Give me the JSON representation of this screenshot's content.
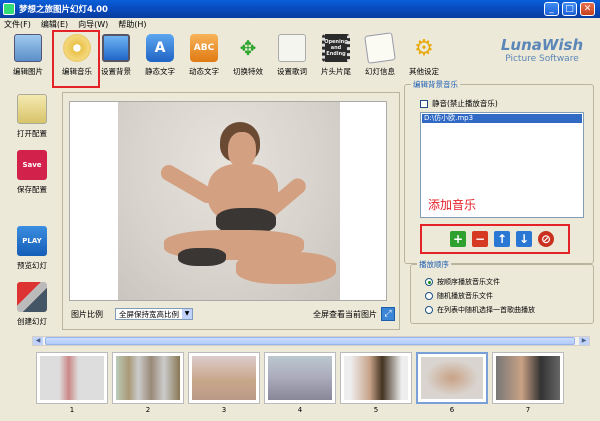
{
  "app": {
    "title": "梦想之旅图片幻灯4.00"
  },
  "window_controls": {
    "minimize": "_",
    "maximize": "□",
    "close": "✕"
  },
  "menu": [
    "文件(F)",
    "编辑(E)",
    "向导(W)",
    "帮助(H)"
  ],
  "toolbar": [
    {
      "label": "编辑图片",
      "icon": "image-icon"
    },
    {
      "label": "编辑音乐",
      "icon": "music-cd-icon"
    },
    {
      "label": "设置背景",
      "icon": "monitor-icon"
    },
    {
      "label": "静态文字",
      "icon": "letter-a-icon"
    },
    {
      "label": "动态文字",
      "icon": "abc-icon"
    },
    {
      "label": "切换特效",
      "icon": "arrows-icon"
    },
    {
      "label": "设置歌词",
      "icon": "lyrics-icon"
    },
    {
      "label": "片头片尾",
      "icon": "film-icon"
    },
    {
      "label": "幻灯信息",
      "icon": "notepad-icon"
    },
    {
      "label": "其他设定",
      "icon": "gears-icon"
    }
  ],
  "toolbar_glyphs": {
    "abc": "ABC",
    "a": "A",
    "film": "Opening and Ending"
  },
  "logo": {
    "line1": "LunaWish",
    "line2": "Picture Software"
  },
  "sidebar": [
    {
      "label": "打开配置",
      "icon": "open-config-icon"
    },
    {
      "label": "保存配置",
      "icon": "save-config-icon",
      "glyph": "Save"
    },
    {
      "label": "预览幻灯",
      "icon": "preview-play-icon",
      "glyph": "PLAY"
    },
    {
      "label": "创建幻灯",
      "icon": "create-tools-icon"
    }
  ],
  "preview": {
    "ratio_label": "图片比例",
    "ratio_value": "全屏保持宽高比例",
    "fullscreen_label": "全屏查看当前图片"
  },
  "music": {
    "group_title": "编辑背景音乐",
    "mute_label": "静音(禁止播放音乐)",
    "mute_checked": false,
    "list": [
      "D:\\仿小欧.mp3"
    ],
    "annotation": "添加音乐",
    "buttons": [
      {
        "name": "add",
        "glyph": "+",
        "color": "#2fa12f"
      },
      {
        "name": "remove",
        "glyph": "−",
        "color": "#d63a22"
      },
      {
        "name": "move-up",
        "glyph": "↑",
        "color": "#2b78d4"
      },
      {
        "name": "move-down",
        "glyph": "↓",
        "color": "#2b78d4"
      },
      {
        "name": "clear",
        "glyph": "⊘",
        "color": "#c9301f"
      }
    ]
  },
  "order": {
    "group_title": "播放顺序",
    "options": [
      "按顺序播放音乐文件",
      "随机播放音乐文件",
      "在列表中随机选择一首歌曲播放"
    ],
    "selected": 0
  },
  "thumbnails": [
    "1",
    "2",
    "3",
    "4",
    "5",
    "6",
    "7"
  ],
  "selected_thumbnail": 4,
  "scroll": {
    "left": "◀",
    "right": "▶"
  },
  "accent_color": "#e52228"
}
